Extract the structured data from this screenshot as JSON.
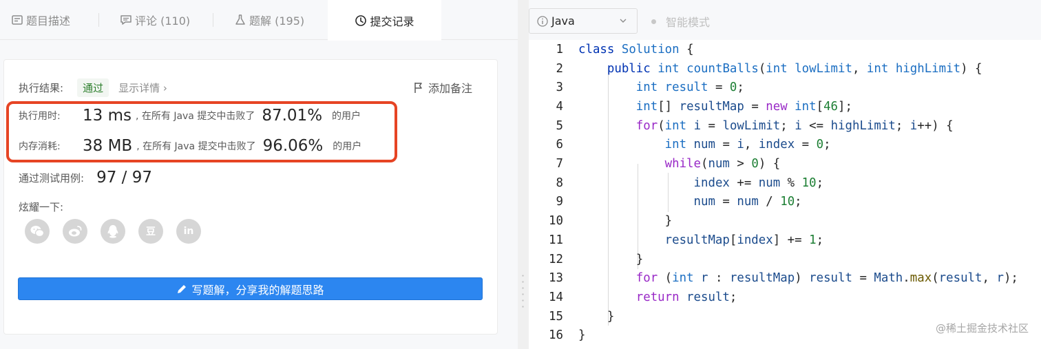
{
  "tabs": [
    {
      "label": "题目描述",
      "icon": "description-icon"
    },
    {
      "label": "评论 (110)",
      "icon": "comment-icon"
    },
    {
      "label": "题解 (195)",
      "icon": "flask-icon"
    },
    {
      "label": "提交记录",
      "icon": "clock-icon",
      "active": true
    }
  ],
  "result": {
    "label": "执行结果:",
    "status": "通过",
    "details_link": "显示详情 ›",
    "add_note": "添加备注"
  },
  "runtime": {
    "label": "执行用时:",
    "value": "13 ms",
    "middle": ", 在所有 Java 提交中击败了",
    "percent": "87.01%",
    "suffix": "的用户"
  },
  "memory": {
    "label": "内存消耗:",
    "value": "38 MB",
    "middle": ", 在所有 Java 提交中击败了",
    "percent": "96.06%",
    "suffix": "的用户"
  },
  "testcases": {
    "label": "通过测试用例:",
    "value": "97 / 97"
  },
  "share": {
    "label": "炫耀一下:",
    "icons": [
      "wechat-icon",
      "weibo-icon",
      "qq-icon",
      "douban-icon",
      "linkedin-icon"
    ],
    "douban_glyph": "豆",
    "linkedin_glyph": "in"
  },
  "write_button": "写题解，分享我的解题思路",
  "editor": {
    "language": "Java",
    "mode": "智能模式",
    "lines": [
      "class Solution {",
      "    public int countBalls(int lowLimit, int highLimit) {",
      "        int result = 0;",
      "        int[] resultMap = new int[46];",
      "        for(int i = lowLimit; i <= highLimit; i++) {",
      "            int num = i, index = 0;",
      "            while(num > 0) {",
      "                index += num % 10;",
      "                num = num / 10;",
      "            }",
      "            resultMap[index] += 1;",
      "        }",
      "        for (int r : resultMap) result = Math.max(result, r);",
      "        return result;",
      "    }",
      "}"
    ],
    "line_numbers": [
      "1",
      "2",
      "3",
      "4",
      "5",
      "6",
      "7",
      "8",
      "9",
      "10",
      "11",
      "12",
      "13",
      "14",
      "15",
      "16"
    ]
  },
  "watermark": "@稀土掘金技术社区",
  "colors": {
    "accent": "#2c86f0",
    "highlight": "#e64424",
    "pass": "#2d7f2d"
  }
}
